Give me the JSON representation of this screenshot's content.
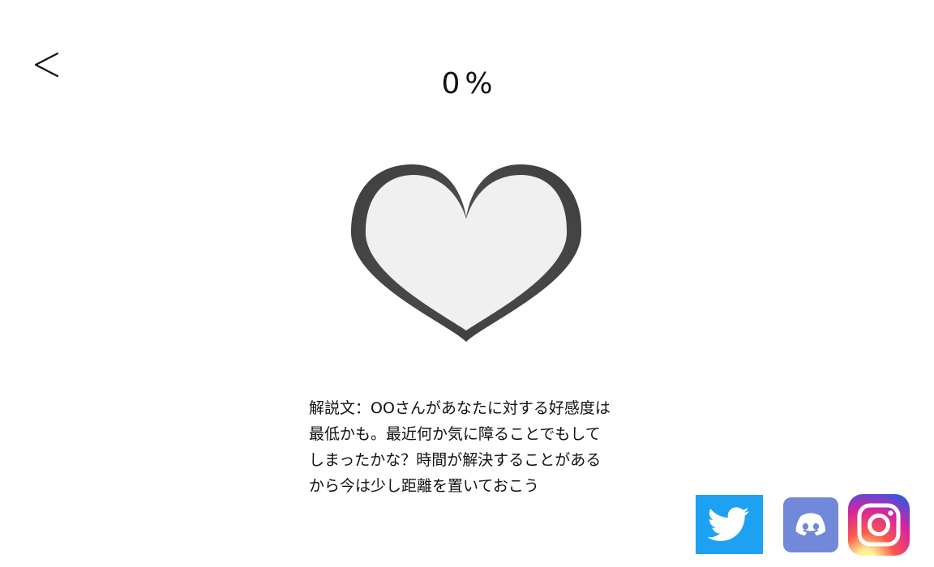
{
  "header": {
    "back_icon": "chevron-left-icon",
    "percent_value": "0",
    "percent_sign": "%"
  },
  "heart": {
    "icon": "heart-icon",
    "outline_color": "#4a4a4a",
    "fill_color": "#f0f0f0",
    "fill_level": 0
  },
  "description": {
    "text": "解説文：OOさんがあなたに対する好感度は\n最低かも。最近何か気に障ることでもして\nしまったかな？時間が解決することがある\nから今は少し距離を置いておこう"
  },
  "social": [
    {
      "name": "twitter",
      "icon": "twitter-icon",
      "color": "#1da1f2"
    },
    {
      "name": "discord",
      "icon": "discord-icon",
      "color": "#7289da"
    },
    {
      "name": "instagram",
      "icon": "instagram-icon",
      "color": "#e1306c"
    }
  ]
}
